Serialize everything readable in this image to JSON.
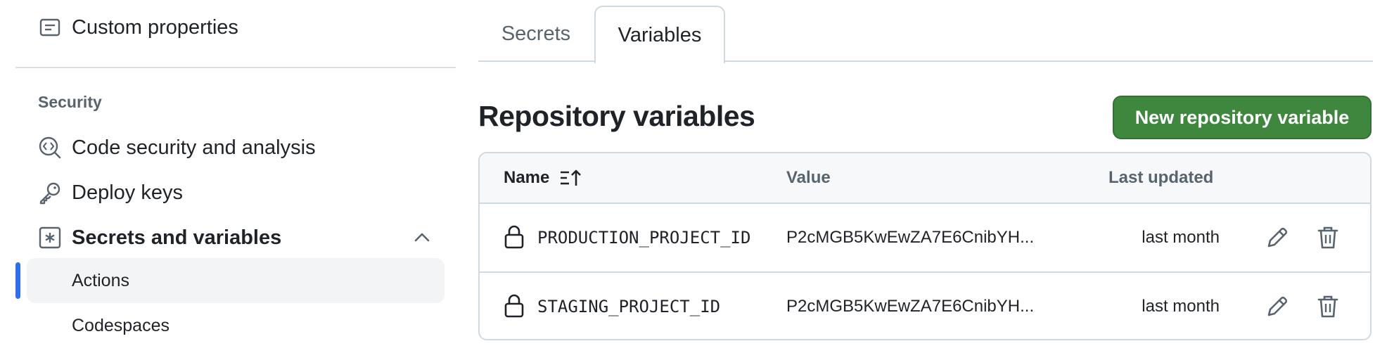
{
  "sidebar": {
    "items": [
      {
        "label": "Custom properties",
        "icon": "note-icon"
      }
    ],
    "section_heading": "Security",
    "security_items": [
      {
        "label": "Code security and analysis",
        "icon": "codescan-icon"
      },
      {
        "label": "Deploy keys",
        "icon": "key-icon"
      },
      {
        "label": "Secrets and variables",
        "icon": "asterisk-icon",
        "expanded": true
      }
    ],
    "sub_items": [
      {
        "label": "Actions",
        "active": true
      },
      {
        "label": "Codespaces",
        "active": false
      }
    ]
  },
  "tabs": [
    {
      "label": "Secrets",
      "selected": false
    },
    {
      "label": "Variables",
      "selected": true
    }
  ],
  "main": {
    "title": "Repository variables",
    "new_button": "New repository variable"
  },
  "table": {
    "columns": {
      "name": "Name",
      "value": "Value",
      "updated": "Last updated"
    },
    "rows": [
      {
        "name": "PRODUCTION_PROJECT_ID",
        "value": "P2cMGB5KwEwZA7E6CnibYH...",
        "updated": "last month"
      },
      {
        "name": "STAGING_PROJECT_ID",
        "value": "P2cMGB5KwEwZA7E6CnibYH...",
        "updated": "last month"
      }
    ]
  },
  "colors": {
    "accent": "#2f6feb",
    "primary_button": "#3f873f",
    "muted_text": "#59636e",
    "border": "#d1d9e0"
  }
}
